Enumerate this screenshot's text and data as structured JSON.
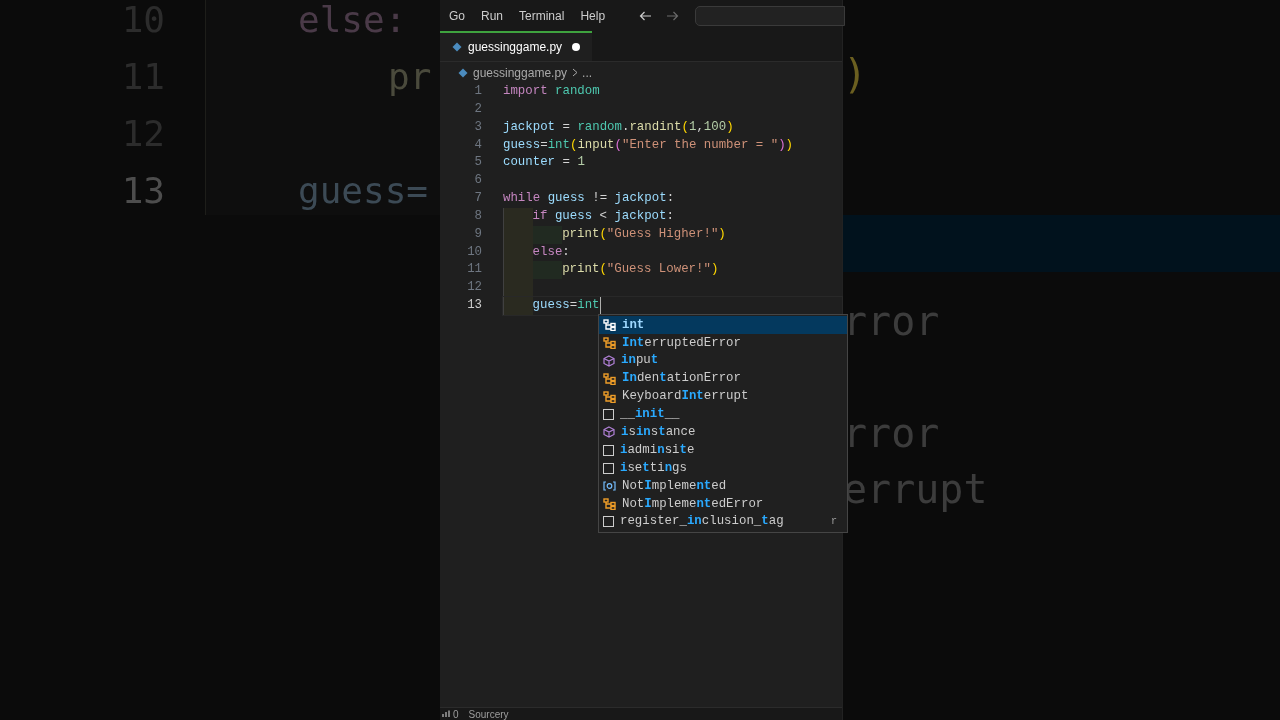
{
  "backdrop": {
    "left": [
      {
        "number": "10",
        "code": "else:",
        "kind": "keyword",
        "active": false
      },
      {
        "number": "11",
        "code": "pr",
        "kind": "function",
        "active": false
      },
      {
        "number": "12",
        "active": false
      },
      {
        "number": "13",
        "code": "guess=",
        "kind": "variable",
        "active": true
      }
    ],
    "right": [
      {
        "text": ")",
        "kind": "paren"
      },
      {
        "text": "rror",
        "kind": "plain"
      },
      {
        "text": "rror",
        "kind": "plain"
      },
      {
        "text": "errupt",
        "kind": "plain"
      }
    ]
  },
  "menu": [
    "Go",
    "Run",
    "Terminal",
    "Help"
  ],
  "tab": {
    "label": "guessinggame.py",
    "dirty": true,
    "selected": true
  },
  "breadcrumb": [
    "guessinggame.py",
    "..."
  ],
  "lines": [
    {
      "number": "1",
      "active": false,
      "tokens": [
        {
          "text": "import ",
          "kind": "keyword"
        },
        {
          "text": "random",
          "kind": "module"
        }
      ]
    },
    {
      "number": "2",
      "active": false
    },
    {
      "number": "3",
      "active": false,
      "tokens": [
        {
          "text": "jackpot",
          "kind": "variable"
        },
        {
          "text": " = ",
          "kind": "plain"
        },
        {
          "text": "random",
          "kind": "module"
        },
        {
          "text": ".",
          "kind": "plain"
        },
        {
          "text": "randint",
          "kind": "function"
        },
        {
          "text": "(",
          "kind": "paren"
        },
        {
          "text": "1",
          "kind": "number"
        },
        {
          "text": ",",
          "kind": "plain"
        },
        {
          "text": "100",
          "kind": "number"
        },
        {
          "text": ")",
          "kind": "paren"
        }
      ]
    },
    {
      "number": "4",
      "active": false,
      "tokens": [
        {
          "text": "guess",
          "kind": "variable"
        },
        {
          "text": "=",
          "kind": "plain"
        },
        {
          "text": "int",
          "kind": "module"
        },
        {
          "text": "(",
          "kind": "paren"
        },
        {
          "text": "input",
          "kind": "function"
        },
        {
          "text": "(",
          "kind": "paren2"
        },
        {
          "text": "\"Enter the number = \"",
          "kind": "string"
        },
        {
          "text": ")",
          "kind": "paren2"
        },
        {
          "text": ")",
          "kind": "paren"
        }
      ]
    },
    {
      "number": "5",
      "active": false,
      "tokens": [
        {
          "text": "counter",
          "kind": "variable"
        },
        {
          "text": " = ",
          "kind": "plain"
        },
        {
          "text": "1",
          "kind": "number"
        }
      ]
    },
    {
      "number": "6",
      "active": false
    },
    {
      "number": "7",
      "active": false,
      "tokens": [
        {
          "text": "while ",
          "kind": "keyword"
        },
        {
          "text": "guess",
          "kind": "variable"
        },
        {
          "text": " != ",
          "kind": "plain"
        },
        {
          "text": "jackpot",
          "kind": "variable"
        },
        {
          "text": ":",
          "kind": "plain"
        }
      ],
      "children": [
        {
          "number": "8",
          "active": false,
          "tokens": [
            {
              "text": "if ",
              "kind": "keyword"
            },
            {
              "text": "guess",
              "kind": "variable"
            },
            {
              "text": " < ",
              "kind": "plain"
            },
            {
              "text": "jackpot",
              "kind": "variable"
            },
            {
              "text": ":",
              "kind": "plain"
            }
          ],
          "children": [
            {
              "number": "9",
              "active": false,
              "tokens": [
                {
                  "text": "print",
                  "kind": "function"
                },
                {
                  "text": "(",
                  "kind": "paren"
                },
                {
                  "text": "\"Guess Higher!\"",
                  "kind": "string"
                },
                {
                  "text": ")",
                  "kind": "paren"
                }
              ]
            }
          ]
        },
        {
          "number": "10",
          "active": false,
          "tokens": [
            {
              "text": "else",
              "kind": "keyword"
            },
            {
              "text": ":",
              "kind": "plain"
            }
          ],
          "children": [
            {
              "number": "11",
              "active": false,
              "tokens": [
                {
                  "text": "print",
                  "kind": "function"
                },
                {
                  "text": "(",
                  "kind": "paren"
                },
                {
                  "text": "\"Guess Lower!\"",
                  "kind": "string"
                },
                {
                  "text": ")",
                  "kind": "paren"
                }
              ]
            }
          ]
        },
        {
          "number": "12",
          "active": false
        },
        {
          "number": "13",
          "active": true,
          "cursor": true,
          "tokens": [
            {
              "text": "guess",
              "kind": "variable"
            },
            {
              "text": "=",
              "kind": "plain"
            },
            {
              "text": "int",
              "kind": "module"
            }
          ]
        }
      ]
    }
  ],
  "suggestions": [
    {
      "label": "**int**",
      "kind": "class",
      "selected": true
    },
    {
      "label": "**Int**erruptedError",
      "kind": "class",
      "selected": false
    },
    {
      "label": "**in**pu**t**",
      "kind": "function",
      "selected": false
    },
    {
      "label": "**In**den**t**ationError",
      "kind": "class",
      "selected": false
    },
    {
      "label": "Keyboard**Int**errupt",
      "kind": "class",
      "selected": false
    },
    {
      "label": "__**init**__",
      "kind": "text",
      "selected": false
    },
    {
      "label": "**i**s**in**s**t**ance",
      "kind": "function",
      "selected": false
    },
    {
      "label": "**i**admi**n**si**t**e",
      "kind": "text",
      "selected": false
    },
    {
      "label": "**i**se**t**ti**n**gs",
      "kind": "text",
      "selected": false
    },
    {
      "label": "Not**I**mpleme**nt**ed",
      "kind": "constant",
      "selected": false
    },
    {
      "label": "Not**I**mpleme**nt**edError",
      "kind": "class",
      "selected": false
    },
    {
      "label": "register_**in**clusion_**t**ag",
      "kind": "text",
      "selected": false,
      "detail": "r"
    }
  ],
  "status": [
    "0",
    "Sourcery"
  ]
}
